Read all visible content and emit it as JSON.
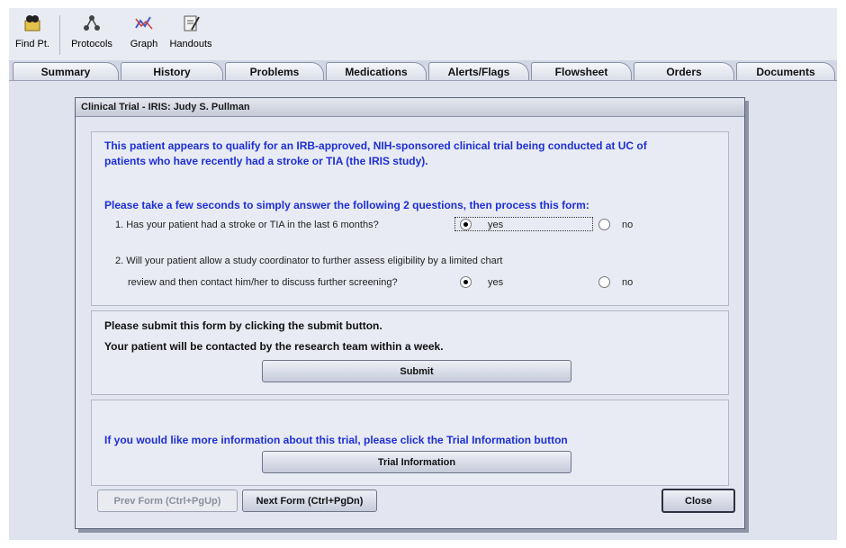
{
  "toolbar": {
    "items": [
      {
        "label": "Find Pt.",
        "icon": "binoculars-icon"
      },
      {
        "label": "Protocols",
        "icon": "protocols-icon"
      },
      {
        "label": "Graph",
        "icon": "graph-icon"
      },
      {
        "label": "Handouts",
        "icon": "handouts-icon"
      }
    ]
  },
  "tabs": [
    "Summary",
    "History",
    "Problems",
    "Medications",
    "Alerts/Flags",
    "Flowsheet",
    "Orders",
    "Documents"
  ],
  "dialog": {
    "title": "Clinical Trial - IRIS:  Judy S. Pullman",
    "intro_line1": "This patient appears to qualify for an IRB-approved, NIH-sponsored clinical trial being conducted at UC of",
    "intro_line2": "patients who have recently had a stroke or TIA (the IRIS study).",
    "instruction": "Please take a few seconds to simply answer the following 2 questions, then process this form:",
    "q1": {
      "text": "1. Has your patient had a stroke or TIA in the last 6 months?",
      "yes": "yes",
      "no": "no",
      "selected": "yes"
    },
    "q2": {
      "line1": "2. Will your patient allow a study coordinator to further assess eligibility by a limited chart",
      "line2": "review and then contact him/her to discuss further screening?",
      "yes": "yes",
      "no": "no",
      "selected": "yes"
    },
    "submit_note1": "Please submit this form by clicking the submit button.",
    "submit_note2": "Your patient will be contacted by the research team within a week.",
    "submit_label": "Submit",
    "info_text": "If you would like more information about this trial, please click the Trial Information button",
    "info_label": "Trial Information",
    "prev_label": "Prev Form (Ctrl+PgUp)",
    "next_label": "Next Form (Ctrl+PgDn)",
    "close_label": "Close"
  },
  "colors": {
    "accent_text": "#1d2fd6",
    "background": "#dfe3ee"
  }
}
